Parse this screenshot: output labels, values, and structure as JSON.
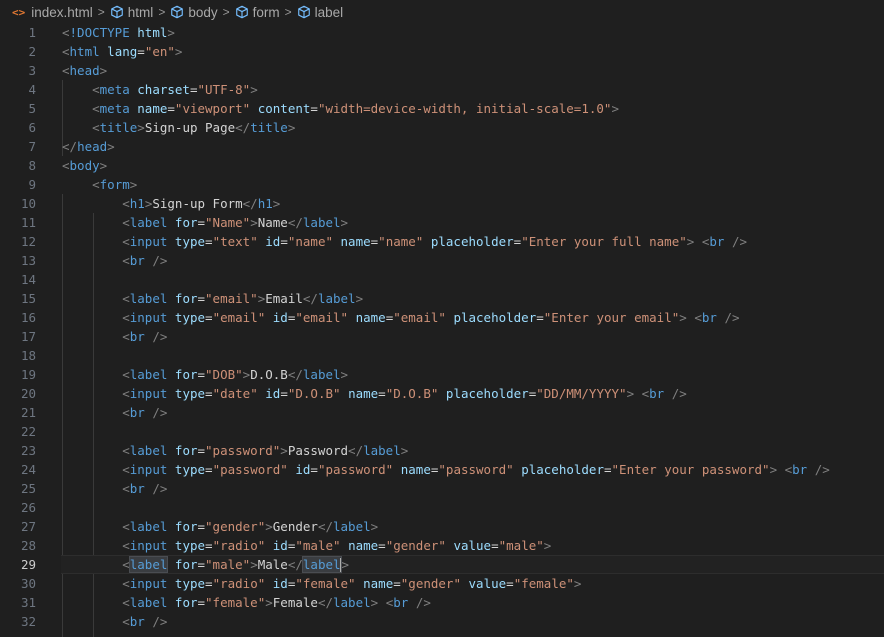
{
  "breadcrumb": {
    "file": "index.html",
    "items": [
      "html",
      "body",
      "form",
      "label"
    ]
  },
  "editor": {
    "current_line": 29,
    "line_numbers": [
      "1",
      "2",
      "3",
      "4",
      "5",
      "6",
      "7",
      "8",
      "9",
      "10",
      "11",
      "12",
      "13",
      "14",
      "15",
      "16",
      "17",
      "18",
      "19",
      "20",
      "21",
      "22",
      "23",
      "24",
      "25",
      "26",
      "27",
      "28",
      "29",
      "30",
      "31",
      "32"
    ]
  },
  "colors": {
    "background": "#1f1f1f",
    "tag": "#569cd6",
    "attribute": "#9cdcfe",
    "string": "#ce9178",
    "text": "#d4d4d4",
    "file_icon": "#e37933"
  }
}
